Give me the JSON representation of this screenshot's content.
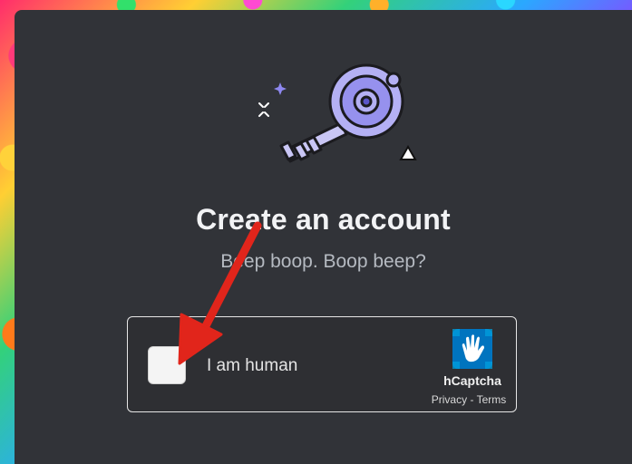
{
  "page": {
    "title": "Create an account",
    "subtitle": "Beep boop. Boop beep?"
  },
  "captcha": {
    "checkbox_label": "I am human",
    "brand": "hCaptcha",
    "privacy_label": "Privacy",
    "separator": " - ",
    "terms_label": "Terms"
  },
  "colors": {
    "card_bg": "#313338",
    "title": "#f2f3f5",
    "subtitle": "#b5bac1",
    "annotation_arrow": "#e1251b",
    "hcaptcha_teal": "#0074bf",
    "hero_key": "#b4b0f4"
  },
  "icons": {
    "hero": "key-illustration-icon",
    "captcha_logo": "hcaptcha-logo-icon",
    "annotation": "red-arrow-icon"
  }
}
